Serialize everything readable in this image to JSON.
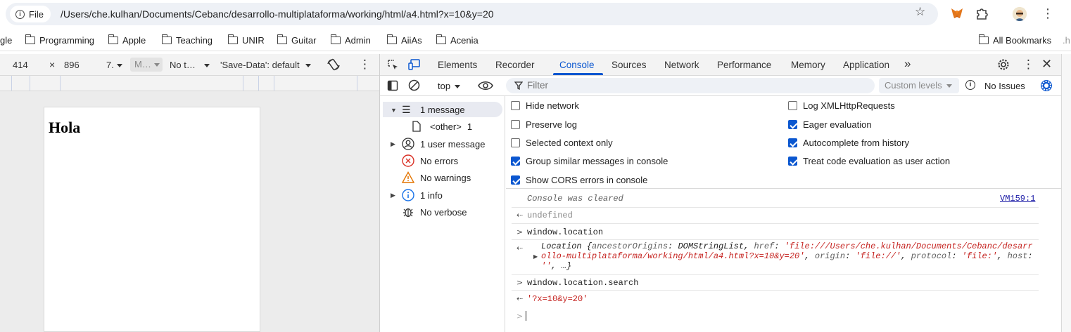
{
  "browser": {
    "site_chip": "File",
    "url": "/Users/che.kulhan/Documents/Cebanc/desarrollo-multiplataforma/working/html/a4.html?x=10&y=20",
    "icons": [
      "info-icon",
      "star-icon",
      "metamask-fox-icon",
      "puzzle-extensions-icon",
      "profile-avatar",
      "more-vert-icon"
    ]
  },
  "bookmarks": {
    "partial_first": "gle",
    "items": [
      "Programming",
      "Apple",
      "Teaching",
      "UNIR",
      "Guitar",
      "Admin",
      "AiiAs",
      "Acenia"
    ],
    "all_bookmarks": "All Bookmarks",
    "right_fragment": ".h"
  },
  "device_toolbar": {
    "width": "414",
    "times": "×",
    "height": "896",
    "zoom": "7.",
    "mode": "M…",
    "throttle": "No t…",
    "save_data": "'Save-Data': default"
  },
  "page": {
    "heading": "Hola"
  },
  "devtools": {
    "tabs": [
      "Elements",
      "Recorder",
      "Console",
      "Sources",
      "Network",
      "Performance",
      "Memory",
      "Application"
    ],
    "active_tab": "Console",
    "more_tabs": "»",
    "accent_color": "#0b57d0"
  },
  "console_toolbar": {
    "context": "top",
    "filter_placeholder": "Filter",
    "levels": "Custom levels",
    "issues": "No Issues"
  },
  "sidebar": {
    "messages": "1 message",
    "other": "<other>",
    "other_count": "1",
    "user_messages": "1 user message",
    "errors": "No errors",
    "warnings": "No warnings",
    "info": "1 info",
    "verbose": "No verbose"
  },
  "settings": {
    "left": [
      {
        "label": "Hide network",
        "checked": false
      },
      {
        "label": "Preserve log",
        "checked": false
      },
      {
        "label": "Selected context only",
        "checked": false
      },
      {
        "label": "Group similar messages in console",
        "checked": true
      },
      {
        "label": "Show CORS errors in console",
        "checked": true
      }
    ],
    "right": [
      {
        "label": "Log XMLHttpRequests",
        "checked": false
      },
      {
        "label": "Eager evaluation",
        "checked": true
      },
      {
        "label": "Autocomplete from history",
        "checked": true
      },
      {
        "label": "Treat code evaluation as user action",
        "checked": true
      }
    ]
  },
  "console": {
    "cleared": "Console was cleared",
    "cleared_source": "VM159:1",
    "result_undefined": "undefined",
    "cmd_location": "window.location",
    "location_obj": {
      "name": "Location",
      "brace_open": " {",
      "k1": "ancestorOrigins",
      "v1": "DOMStringList",
      "k2": "href",
      "v2_part1": "'file:///Users/che.kulhan/Documents/Cebanc/desarr",
      "v2_part2": "ollo-multiplataforma/working/html/a4.html?x=10&y=20'",
      "k3": "origin",
      "v3": "'file://'",
      "k4": "protocol",
      "v4": "'file:'",
      "k5": "host",
      "v5": "''",
      "tail": ", …}"
    },
    "cmd_search": "window.location.search",
    "result_search": "'?x=10&y=20'"
  }
}
